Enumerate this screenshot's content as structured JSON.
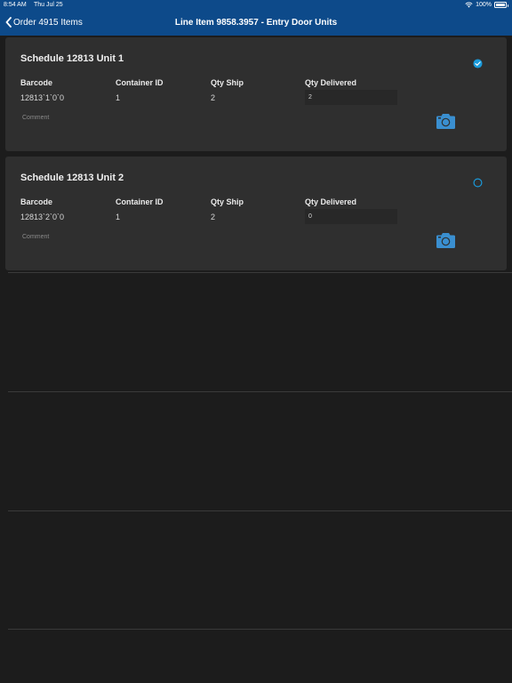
{
  "status_bar": {
    "time": "8:54 AM",
    "date": "Thu Jul 25",
    "battery": "100%"
  },
  "nav": {
    "back_label": "Order 4915 Items",
    "title": "Line Item 9858.3957 - Entry Door Units"
  },
  "columns": {
    "barcode": "Barcode",
    "container_id": "Container ID",
    "qty_ship": "Qty Ship",
    "qty_delivered": "Qty Delivered"
  },
  "units": [
    {
      "title": "Schedule 12813 Unit 1",
      "barcode": "12813`1`0`0",
      "container_id": "1",
      "qty_ship": "2",
      "qty_delivered": "2",
      "comment_placeholder": "Comment",
      "checked": true
    },
    {
      "title": "Schedule 12813 Unit 2",
      "barcode": "12813`2`0`0",
      "container_id": "1",
      "qty_ship": "2",
      "qty_delivered": "0",
      "comment_placeholder": "Comment",
      "checked": false
    }
  ],
  "colors": {
    "nav_bg": "#0d4a8a",
    "accent": "#1a9bdc",
    "camera": "#3a8fd0"
  },
  "icons": [
    "chevron-left-icon",
    "wifi-icon",
    "battery-icon",
    "checkmark-circle-icon",
    "empty-circle-icon",
    "camera-icon"
  ]
}
